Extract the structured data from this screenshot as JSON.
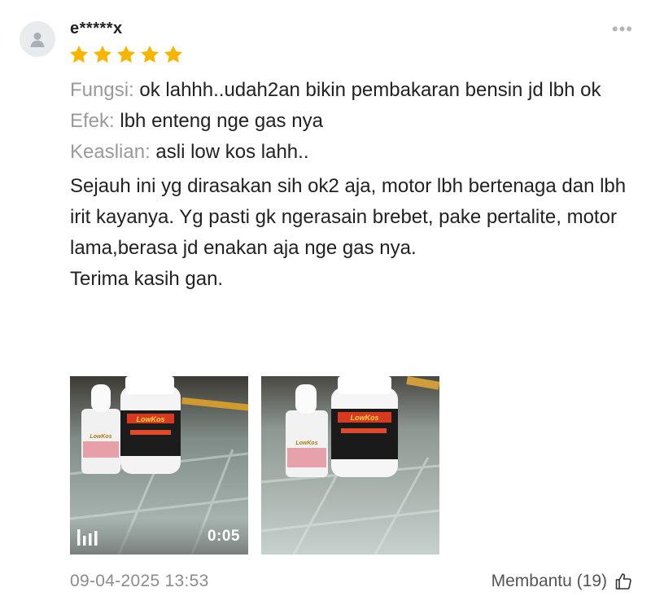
{
  "review": {
    "username": "e*****x",
    "rating": 5,
    "rating_color": "#f7b500",
    "more_icon": "more-horizontal-icon",
    "attributes": [
      {
        "label": "Fungsi:",
        "value": "ok lahhh..udah2an bikin pembakaran bensin jd lbh ok"
      },
      {
        "label": "Efek:",
        "value": "lbh enteng nge gas nya"
      },
      {
        "label": "Keaslian:",
        "value": "asli low kos lahh.."
      }
    ],
    "body_lines": [
      "Sejauh ini yg dirasakan sih ok2 aja, motor lbh bertenaga dan lbh irit kayanya. Yg pasti gk ngerasain brebet, pake pertalite, motor lama,berasa jd enakan aja nge gas nya.",
      "Terima kasih gan."
    ],
    "media": [
      {
        "type": "video",
        "duration": "0:05",
        "icon": "video-bars-icon"
      },
      {
        "type": "image"
      }
    ],
    "timestamp": "09-04-2025 13:53",
    "helpful_label": "Membantu (19)",
    "helpful_icon": "thumbs-up-icon"
  }
}
